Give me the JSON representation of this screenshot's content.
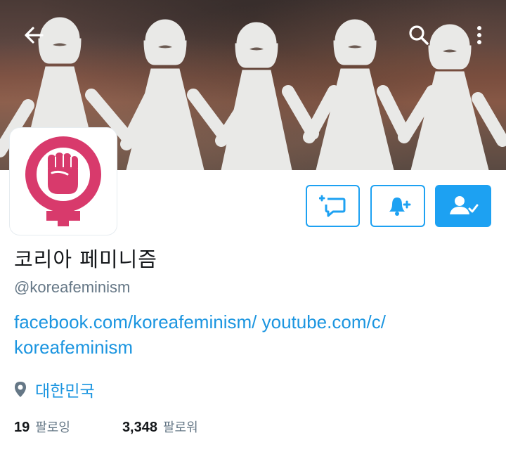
{
  "profile": {
    "display_name": "코리아 페미니즘",
    "handle": "@koreafeminism",
    "bio_links": [
      "facebook.com/koreafeminism/",
      "youtube.com/c/",
      "koreafeminism"
    ],
    "location": "대한민국",
    "following_count": "19",
    "following_label": "팔로잉",
    "followers_count": "3,348",
    "followers_label": "팔로워"
  },
  "header_icons": {
    "back": "arrow-left-icon",
    "search": "search-icon",
    "more": "more-vertical-icon"
  },
  "actions": {
    "dm": "dm-plus-icon",
    "notify": "bell-plus-icon",
    "following": "user-check-icon"
  },
  "colors": {
    "accent": "#1da1f2",
    "link": "#1b95e0",
    "logo_pink": "#d83a6c",
    "muted_text": "#657786"
  }
}
